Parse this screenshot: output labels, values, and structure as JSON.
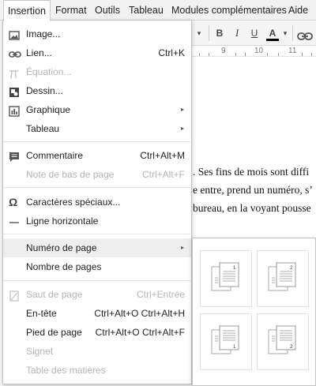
{
  "menubar": {
    "items": [
      "Insertion",
      "Format",
      "Outils",
      "Tableau",
      "Modules complémentaires",
      "Aide"
    ]
  },
  "toolbar": {
    "chevron": "▾",
    "bold": "B",
    "italic": "I",
    "underline": "U",
    "text_color": "A"
  },
  "ruler": {
    "numbers": [
      "9",
      "10",
      "11"
    ]
  },
  "document": {
    "lines": [
      ". Ses fins de mois sont diffi",
      "e entre, prend un numéro, s’",
      "bureau, en la voyant pousse"
    ]
  },
  "insert_menu": {
    "image": {
      "label": "Image..."
    },
    "link": {
      "label": "Lien...",
      "shortcut": "Ctrl+K"
    },
    "equation": {
      "label": "Équation..."
    },
    "drawing": {
      "label": "Dessin..."
    },
    "chart": {
      "label": "Graphique"
    },
    "table": {
      "label": "Tableau"
    },
    "comment": {
      "label": "Commentaire",
      "shortcut": "Ctrl+Alt+M"
    },
    "footnote": {
      "label": "Note de bas de page",
      "shortcut": "Ctrl+Alt+F"
    },
    "special_chars": {
      "label": "Caractères spéciaux..."
    },
    "horizontal_line": {
      "label": "Ligne horizontale"
    },
    "page_number": {
      "label": "Numéro de page"
    },
    "page_count": {
      "label": "Nombre de pages"
    },
    "page_break": {
      "label": "Saut de page",
      "shortcut": "Ctrl+Entrée"
    },
    "header": {
      "label": "En-tête",
      "shortcut": "Ctrl+Alt+O Ctrl+Alt+H"
    },
    "footer": {
      "label": "Pied de page",
      "shortcut": "Ctrl+Alt+O Ctrl+Alt+F"
    },
    "bookmark": {
      "label": "Signet"
    },
    "toc": {
      "label": "Table des matières"
    },
    "submenu_arrow": "▸"
  },
  "page_number_submenu": {
    "options": [
      {
        "name": "header-right-all-pages",
        "number": "1"
      },
      {
        "name": "header-right-skip-first",
        "number": "2"
      },
      {
        "name": "footer-right-all-pages",
        "number": "1"
      },
      {
        "name": "footer-right-skip-first",
        "number": "2"
      }
    ]
  },
  "colors": {
    "menubar_bg": "#f1f1f1",
    "highlight_bg": "#eeeeee",
    "disabled_text": "#b4b4b4",
    "text_color_bar": "#000000"
  }
}
